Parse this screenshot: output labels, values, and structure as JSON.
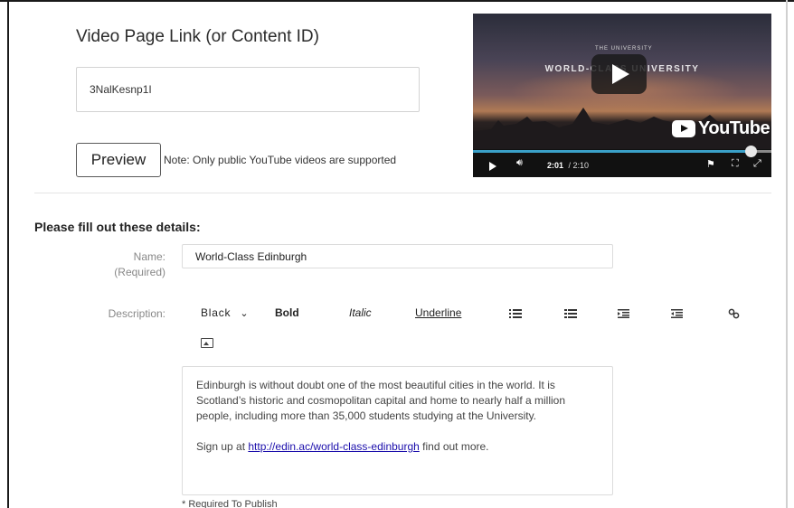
{
  "video_link": {
    "label": "Video Page Link (or Content ID)",
    "value": "3NalKesnp1I",
    "preview_label": "Preview",
    "note": "Note: Only public YouTube videos are supported"
  },
  "video_player": {
    "crest_text": "THE UNIVERSITY",
    "overlay_title": "WORLD-CLASS UNIVERSITY",
    "logo_text": "YouTube",
    "current_time": "2:01",
    "duration": "/ 2:10",
    "progress_fraction": 0.93,
    "icons": {
      "play": "play-icon",
      "volume": "volume-icon",
      "flag": "flag-icon",
      "expand": "expand-icon",
      "fullscreen": "fullscreen-icon"
    },
    "colors": {
      "progress": "#3aa0c8"
    }
  },
  "details": {
    "heading": "Please fill out these details:",
    "name_label": "Name:",
    "name_required": "(Required)",
    "name_value": "World-Class Edinburgh",
    "description_label": "Description:",
    "toolbar": {
      "color_label": "Black",
      "color_chevron": "⌄",
      "bold_label": "Bold",
      "italic_label": "Italic",
      "underline_label": "Underline",
      "icons": [
        "unordered-list-icon",
        "ordered-list-icon",
        "indent-icon",
        "outdent-icon",
        "link-icon",
        "image-icon"
      ]
    },
    "description_text_1": "Edinburgh is without doubt one of the most beautiful cities in the world. It is Scotland’s historic and cosmopolitan capital and home to nearly half a million people, including more than 35,000 students studying at the University.",
    "description_prefix": "Sign up at ",
    "description_link": "http://edin.ac/world-class-edinburgh",
    "description_suffix": " find out more.",
    "required_note": "* Required To Publish"
  }
}
